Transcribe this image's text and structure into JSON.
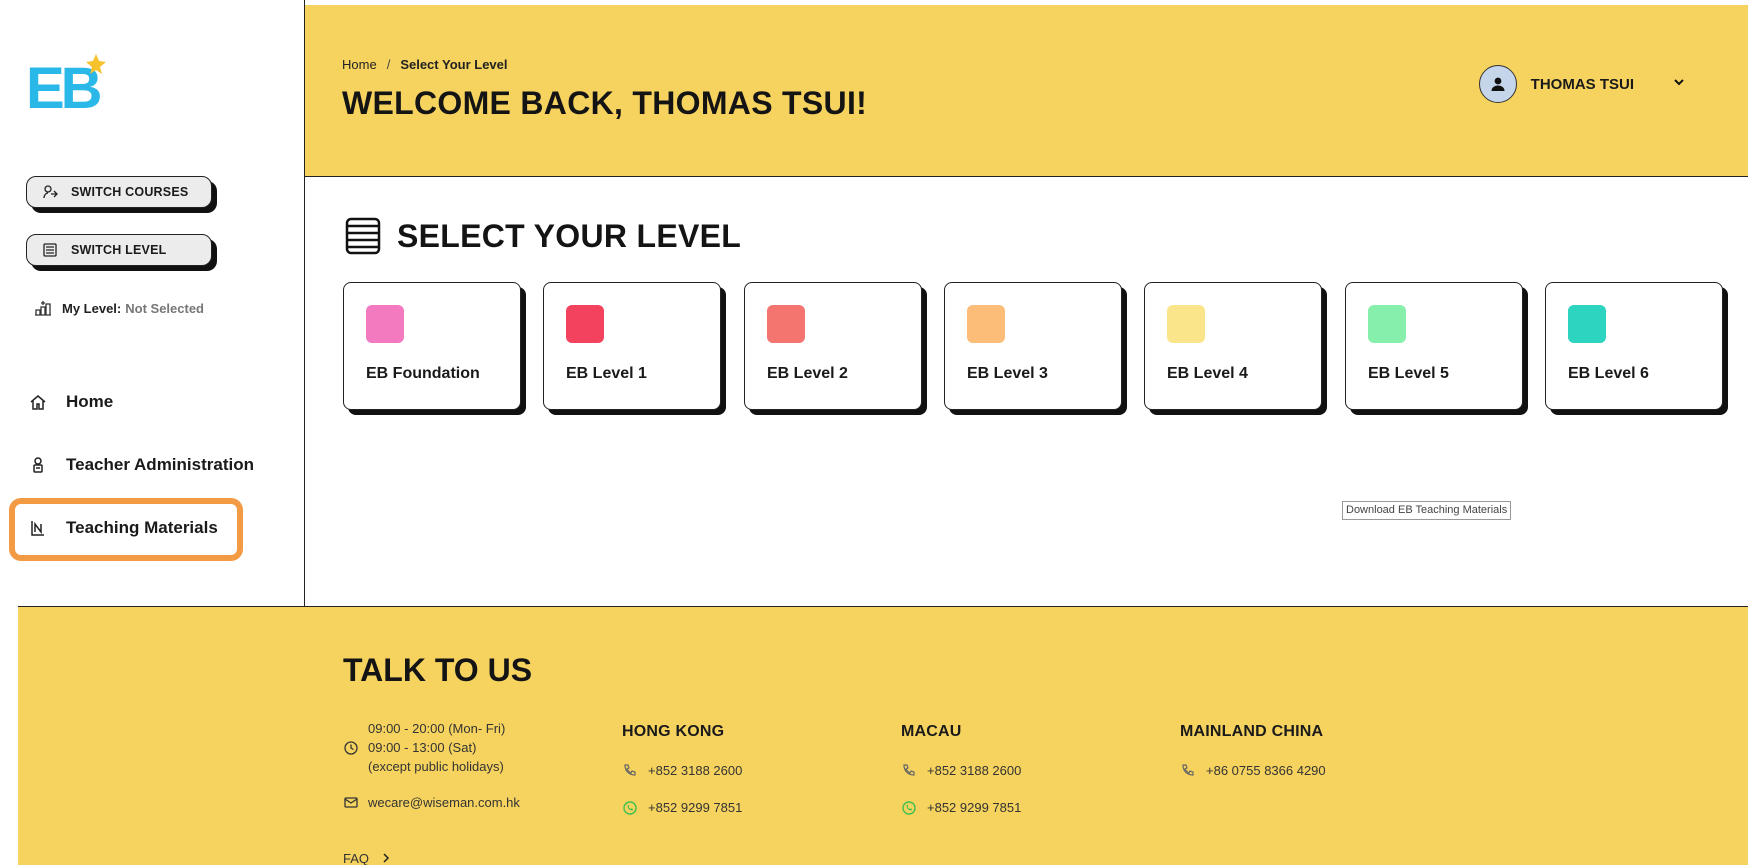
{
  "logo": {
    "text": "EB"
  },
  "sidebar": {
    "switch_courses": "SWITCH COURSES",
    "switch_level": "SWITCH LEVEL",
    "my_level_label": "My Level:",
    "my_level_value": "Not Selected",
    "nav": [
      {
        "label": "Home",
        "icon": "home-icon"
      },
      {
        "label": "Teacher Administration",
        "icon": "teacher-icon"
      },
      {
        "label": "Teaching Materials",
        "icon": "materials-icon",
        "highlighted": true
      }
    ]
  },
  "header": {
    "breadcrumb": [
      "Home",
      "Select Your Level"
    ],
    "breadcrumb_separator": "/",
    "welcome": "WELCOME BACK, THOMAS TSUI!",
    "user_name": "THOMAS TSUI"
  },
  "main": {
    "section_title": "SELECT YOUR LEVEL",
    "levels": [
      {
        "label": "EB Foundation",
        "color": "#f47ac0"
      },
      {
        "label": "EB Level 1",
        "color": "#f2425e"
      },
      {
        "label": "EB Level 2",
        "color": "#f47470"
      },
      {
        "label": "EB Level 3",
        "color": "#fbbd78"
      },
      {
        "label": "EB Level 4",
        "color": "#fbe58a"
      },
      {
        "label": "EB Level 5",
        "color": "#86efac"
      },
      {
        "label": "EB Level 6",
        "color": "#2dd4bf"
      }
    ],
    "download_label": "Download EB Teaching Materials"
  },
  "footer": {
    "title": "TALK TO US",
    "hours": [
      "09:00 - 20:00 (Mon- Fri)",
      "09:00 - 13:00 (Sat)",
      "(except public holidays)"
    ],
    "email": "wecare@wiseman.com.hk",
    "faq": "FAQ",
    "regions": [
      {
        "name": "HONG KONG",
        "phone": "+852 3188 2600",
        "whatsapp": "+852 9299 7851"
      },
      {
        "name": "MACAU",
        "phone": "+852 3188 2600",
        "whatsapp": "+852 9299 7851"
      },
      {
        "name": "MAINLAND CHINA",
        "phone": "+86 0755 8366 4290"
      }
    ]
  },
  "colors": {
    "brand_yellow": "#f6d35f",
    "highlight_orange": "#f39a45",
    "logo_blue": "#29b8e8",
    "logo_yellow": "#f5c12c"
  }
}
